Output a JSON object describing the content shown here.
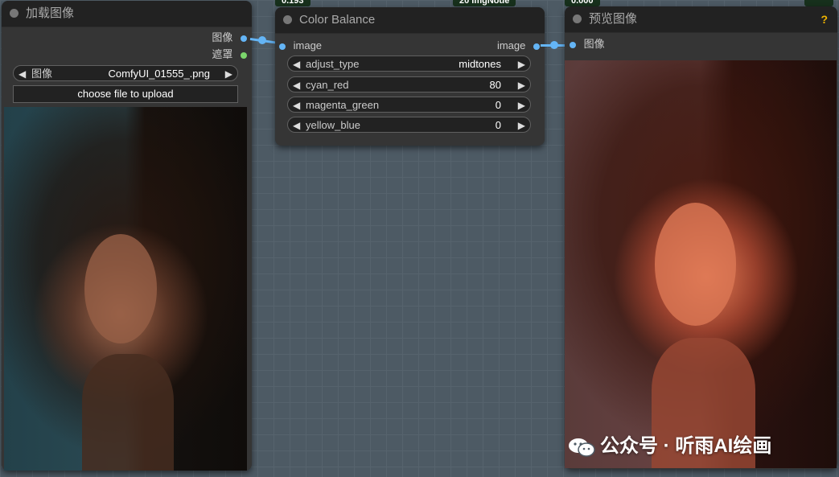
{
  "top_tags": [
    "0.193",
    "20 ImgNode",
    "0.000"
  ],
  "load_image_node": {
    "title": "加载图像",
    "outputs": [
      "图像",
      "遮罩"
    ],
    "image_widget": {
      "label": "图像",
      "value": "ComfyUI_01555_.png"
    },
    "upload_button": "choose file to upload"
  },
  "color_balance_node": {
    "title": "Color Balance",
    "input": "image",
    "output": "image",
    "widgets": [
      {
        "label": "adjust_type",
        "value": "midtones"
      },
      {
        "label": "cyan_red",
        "value": "80"
      },
      {
        "label": "magenta_green",
        "value": "0"
      },
      {
        "label": "yellow_blue",
        "value": "0"
      }
    ]
  },
  "preview_node": {
    "title": "预览图像",
    "input": "图像",
    "help": "?"
  },
  "watermark": "公众号 · 听雨AI绘画",
  "colors": {
    "link": "#64b5f6",
    "mask_port": "#7bd66c",
    "help": "#f0b400"
  }
}
